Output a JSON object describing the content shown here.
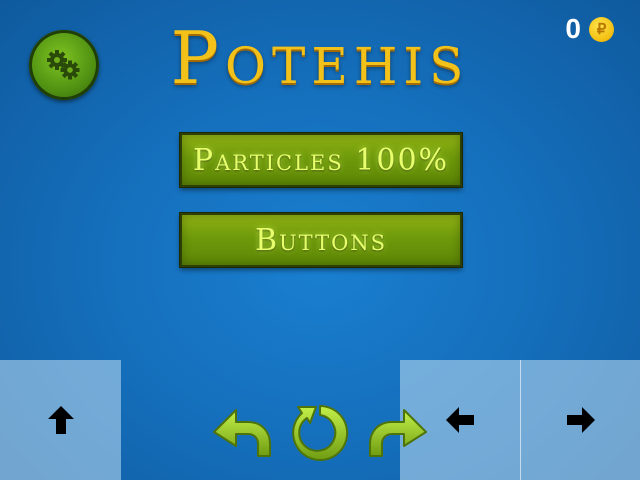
{
  "game": {
    "title": "Potehis"
  },
  "hud": {
    "coin_count": "0",
    "coin_symbol": "₽",
    "coin_icon": "coin-icon"
  },
  "menu": {
    "particles_label": "Particles 100%",
    "buttons_label": "Buttons"
  },
  "controls": {
    "settings_icon": "gears-icon",
    "undo_icon": "undo-arrow-icon",
    "restart_icon": "restart-icon",
    "redo_icon": "redo-arrow-icon",
    "up_icon": "arrow-up-icon",
    "left_icon": "arrow-left-icon",
    "right_icon": "arrow-right-icon"
  },
  "colors": {
    "background": "#1570bd",
    "title": "#f3c21a",
    "button_green": "#6f9a0b",
    "button_text": "#e6ff6a",
    "icon_green": "#8fc21c",
    "pad": "#afd2eb"
  }
}
